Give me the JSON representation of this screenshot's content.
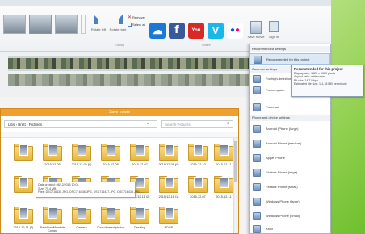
{
  "ribbon": {
    "rotate_left": "Rotate left",
    "rotate_right": "Rotate right",
    "remove": "Remove",
    "select_all": "Select all",
    "editing_group": "Editing",
    "share_group": "Share",
    "save_movie": "Save movie",
    "sign_in": "Sign in"
  },
  "services": [
    {
      "name": "cloud-icon",
      "color": "#1b78d4",
      "glyph": "☁"
    },
    {
      "name": "facebook-icon",
      "color": "#3b5998",
      "glyph": "f"
    },
    {
      "name": "youtube-icon",
      "color": "#d62a26",
      "glyph": "You"
    },
    {
      "name": "vimeo-icon",
      "color": "#1ab7ea",
      "glyph": "V"
    },
    {
      "name": "flickr-icon",
      "color": "#ffffff",
      "glyph": "●●"
    }
  ],
  "settings_menu": {
    "header_recommended": "Recommended settings",
    "recommended_item": "Recommended for this project",
    "header_common": "Common settings",
    "common_items": [
      "For high-definition display",
      "For computer",
      "For email"
    ],
    "header_phone": "Phone and device settings",
    "phone_items": [
      "Android (Phone (large)",
      "Android Phone (medium)",
      "Apple iPhone",
      "Feature Phone (large)",
      "Feature Phone (small)",
      "Windows Phone (large)",
      "Windows Phone (small)",
      "Xbox"
    ]
  },
  "tooltip": {
    "title": "Recommended for this project",
    "lines": [
      "Display size: 1920 x 1080 pixels",
      "Aspect ratio: widescreen",
      "Bit rate: 14.7 Mbps",
      "Estimated file size: 111.18 MB per minute"
    ]
  },
  "save_dialog": {
    "title": "Save movie",
    "path": "Libs › Brett › Pictures",
    "search_placeholder": "Search Pictures"
  },
  "folders_row1": [
    "",
    "2015-12-05",
    "2015-12-06 (6)",
    "2015-12-08",
    "2015-12-07",
    "2015-12-08 (0)",
    "2015-12-10",
    "2015-12-11"
  ],
  "folders_row2": [
    "",
    "2015-12-05 (2)",
    "2015-12-08 (4)",
    "2015-12-09 (4)",
    "2015-12-11 (2)",
    "2015-12-11 (1)",
    "2015-12-07",
    "2015-12-11"
  ],
  "folders_row3": [
    "2015-12-11 (2)",
    "BlackDawManésité Compo",
    "Camera",
    "Consolidated photos",
    "Desktop",
    "EDGE"
  ],
  "explorer_tip": [
    "Date created: 08/12/2015 10:04",
    "Size: 75.4 MB",
    "Files: DSC716435.JPG, DSC716436.JPG, DSC716437.JPG, DSC716438.JPG, ..."
  ]
}
